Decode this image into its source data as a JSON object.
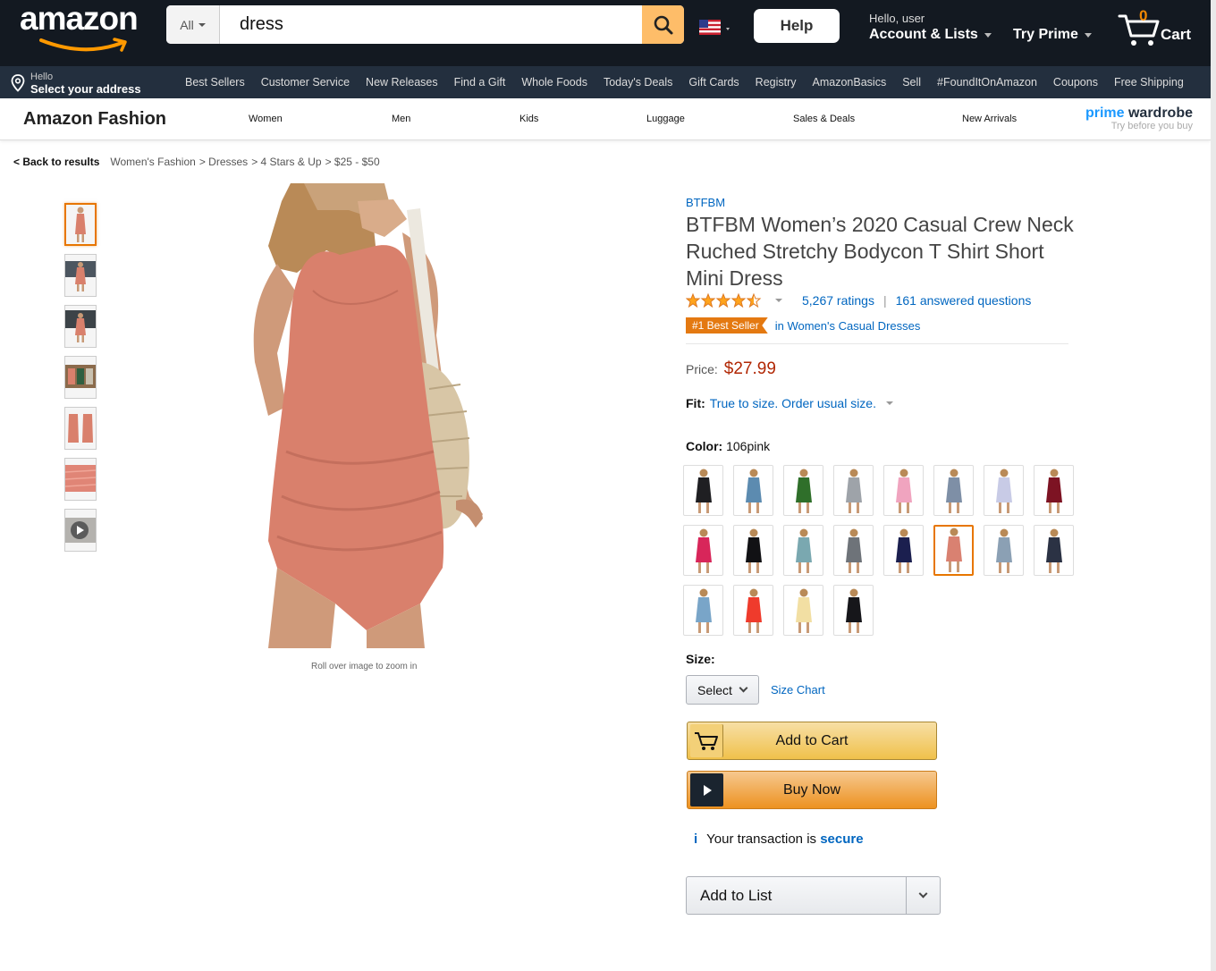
{
  "header": {
    "logo": "amazon",
    "search_dept": "All",
    "search_value": "dress",
    "help_label": "Help",
    "greeting": "Hello, user",
    "account_label": "Account & Lists",
    "prime_label": "Try Prime",
    "cart_count": "0",
    "cart_label": "Cart"
  },
  "address": {
    "hello": "Hello",
    "prompt": "Select your address"
  },
  "navlinks": [
    "Best Sellers",
    "Customer Service",
    "New Releases",
    "Find a Gift",
    "Whole Foods",
    "Today's Deals",
    "Gift Cards",
    "Registry",
    "AmazonBasics",
    "Sell",
    "#FoundItOnAmazon",
    "Coupons",
    "Free Shipping"
  ],
  "fashion": {
    "title": "Amazon Fashion",
    "links": [
      "Women",
      "Men",
      "Kids",
      "Luggage",
      "Sales & Deals",
      "New Arrivals"
    ],
    "prime_wardrobe_a": "prime",
    "prime_wardrobe_b": " wardrobe",
    "prime_wardrobe_tag": "Try before you buy"
  },
  "breadcrumb": {
    "back": "< Back to results",
    "path": [
      "Women's Fashion",
      "> Dresses",
      "> 4 Stars & Up",
      "> $25 - $50"
    ]
  },
  "gallery": {
    "rollover": "Roll over image to zoom in",
    "thumb_count": 7
  },
  "product": {
    "brand": "BTFBM",
    "title": "BTFBM Women’s 2020 Casual Crew Neck Ruched Stretchy Bodycon T Shirt Short Mini Dress",
    "rating": 4.5,
    "ratings_count": "5,267 ratings",
    "answered": "161 answered questions",
    "best_seller_badge": "#1 Best Seller",
    "best_seller_category": "in Women's Casual Dresses",
    "price_label": "Price:",
    "price": "$27.99",
    "fit_label": "Fit:",
    "fit_value": "True to size. Order usual size.",
    "color_label": "Color:",
    "color_value": "106pink",
    "size_label": "Size:",
    "size_select": "Select",
    "size_chart": "Size Chart",
    "add_to_cart": "Add to Cart",
    "buy_now": "Buy Now",
    "secure_text": "Your transaction is",
    "secure_link": "secure",
    "add_to_list": "Add to List"
  },
  "swatch_colors": [
    "#1f1f22",
    "#5c8bb0",
    "#2f6f2a",
    "#9ea3a9",
    "#f0a4bf",
    "#7e8fa6",
    "#c8cbe6",
    "#7d1323",
    "#d8265a",
    "#111114",
    "#7aa8b0",
    "#6e7379",
    "#1b1f4f",
    "#d98171",
    "#8ba0b4",
    "#2b3244",
    "#79a5c8",
    "#ef3b2c",
    "#f2dfa3",
    "#16161a"
  ],
  "selected_swatch": 13,
  "colors": {
    "nav": "#131921",
    "nav2": "#232f3e",
    "link": "#0066c0",
    "price": "#b12704",
    "accent": "#e77600"
  }
}
